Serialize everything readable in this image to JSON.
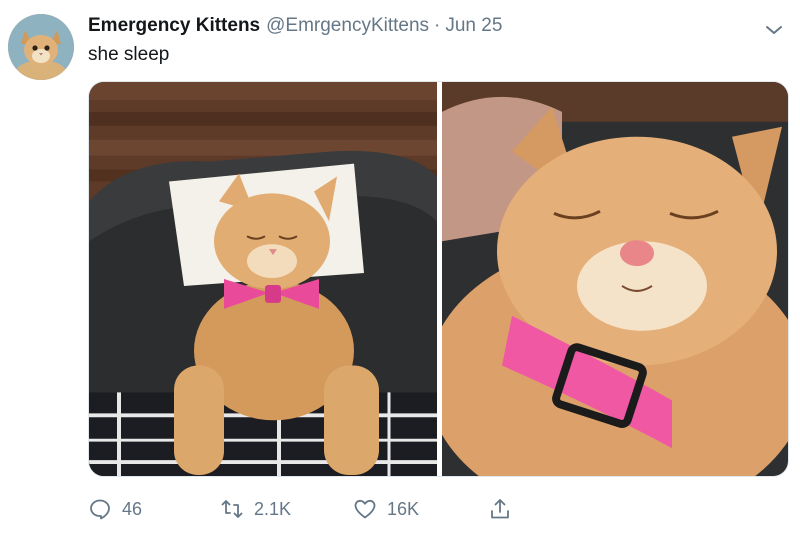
{
  "tweet": {
    "author_name": "Emergency Kittens",
    "handle": "@EmrgencyKittens",
    "separator": "·",
    "date": "Jun 25",
    "text": "she sleep"
  },
  "actions": {
    "reply_count": "46",
    "retweet_count": "2.1K",
    "like_count": "16K"
  },
  "icons": {
    "reply": "reply-icon",
    "retweet": "retweet-icon",
    "like": "heart-icon",
    "share": "share-icon",
    "menu": "chevron-down-icon"
  },
  "colors": {
    "text_primary": "#14171a",
    "text_secondary": "#657786",
    "border": "#e1e8ed"
  }
}
